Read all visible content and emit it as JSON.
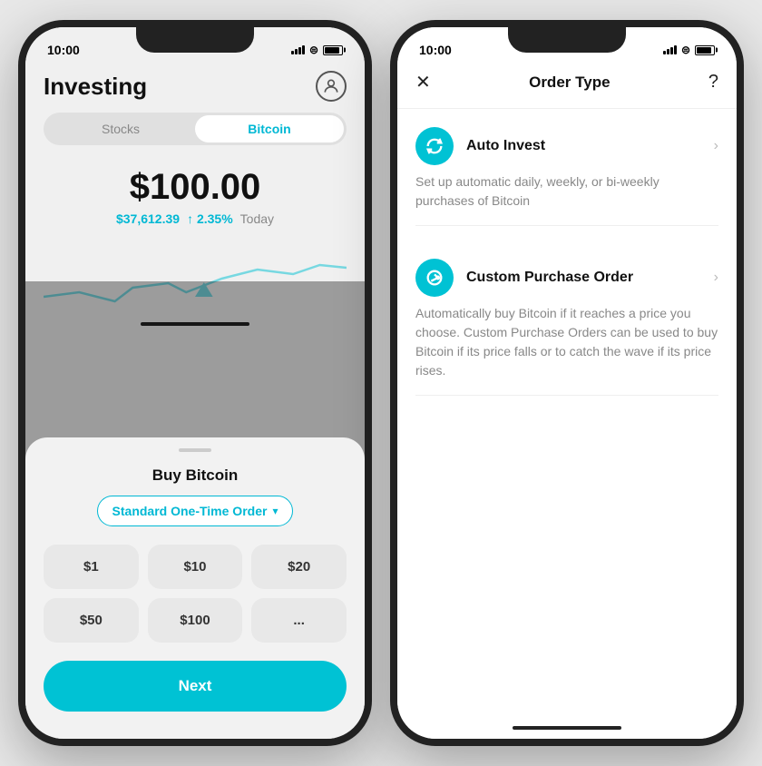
{
  "left_phone": {
    "status_time": "10:00",
    "header": {
      "title": "Investing",
      "profile_icon": "👤"
    },
    "tabs": [
      {
        "label": "Stocks",
        "active": false
      },
      {
        "label": "Bitcoin",
        "active": true
      }
    ],
    "price_main": "$100.00",
    "price_btc": "$37,612.39",
    "price_change": "↑ 2.35%",
    "price_period": "Today",
    "bottom_sheet": {
      "title": "Buy Bitcoin",
      "order_type_label": "Standard One-Time Order",
      "amounts": [
        "$1",
        "$10",
        "$20",
        "$50",
        "$100",
        "..."
      ],
      "next_label": "Next"
    }
  },
  "right_phone": {
    "status_time": "10:00",
    "header": {
      "close_label": "✕",
      "title": "Order Type",
      "help_label": "?"
    },
    "options": [
      {
        "name": "Auto Invest",
        "icon": "↻",
        "description": "Set up automatic daily, weekly, or bi-weekly purchases of Bitcoin"
      },
      {
        "name": "Custom Purchase Order",
        "icon": "↗",
        "description": "Automatically buy Bitcoin if it reaches a price you choose. Custom Purchase Orders can be used to buy Bitcoin if its price falls or to catch the wave if its price rises."
      }
    ]
  }
}
